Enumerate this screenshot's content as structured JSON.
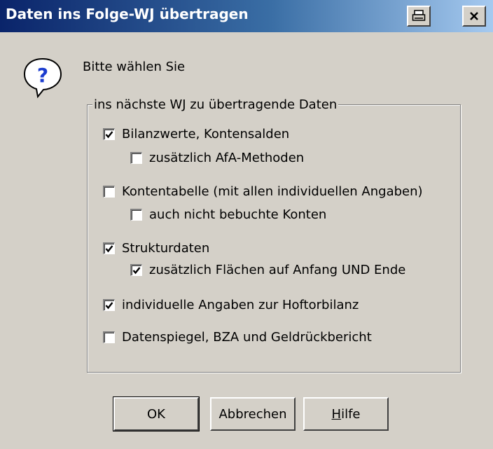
{
  "window": {
    "title": "Daten ins Folge-WJ übertragen"
  },
  "dialog": {
    "prompt": "Bitte wählen Sie",
    "icon": "question-icon",
    "group_label": "ins nächste WJ zu übertragende Daten",
    "options": [
      {
        "label": "Bilanzwerte, Kontensalden",
        "checked": true
      },
      {
        "label": "zusätzlich AfA-Methoden",
        "checked": false
      },
      {
        "label": "Kontentabelle (mit allen individuellen Angaben)",
        "checked": false
      },
      {
        "label": "auch nicht bebuchte Konten",
        "checked": false
      },
      {
        "label": "Strukturdaten",
        "checked": true
      },
      {
        "label": "zusätzlich Flächen auf Anfang UND Ende",
        "checked": true
      },
      {
        "label": "individuelle Angaben zur Hoftorbilanz",
        "checked": true
      },
      {
        "label": "Datenspiegel, BZA und Geldrückbericht",
        "checked": false
      }
    ]
  },
  "buttons": {
    "ok": "OK",
    "cancel": "Abbrechen",
    "help_underlined": "H",
    "help_rest": "ilfe"
  },
  "colors": {
    "face": "#d4d0c8",
    "title_start": "#0a246a",
    "title_end": "#a6caf0"
  }
}
